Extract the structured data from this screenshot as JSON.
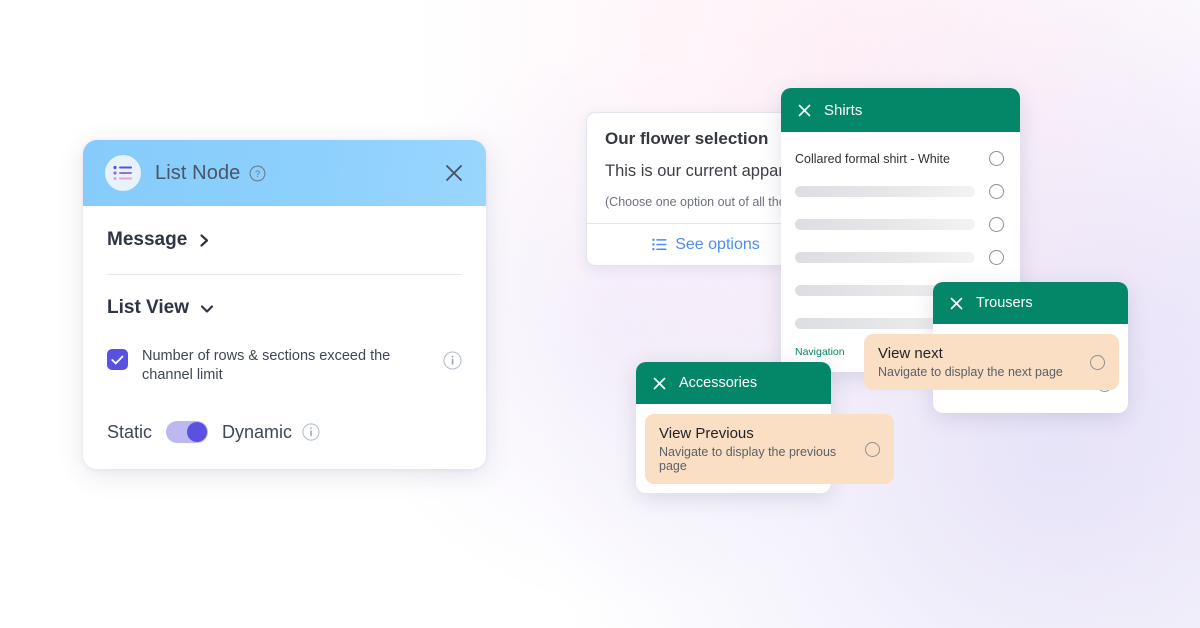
{
  "theme": {
    "header_blue": "#8acdfb",
    "green": "#048768",
    "peach": "#fbdfc5",
    "indigo": "#5a51e0",
    "link_blue": "#4a8bf4"
  },
  "list_node": {
    "icon": "list-icon",
    "title": "List Node",
    "help_icon": "question-circle-icon",
    "close_icon": "close-icon",
    "message": {
      "label": "Message",
      "chevron": "chevron-right-icon"
    },
    "list_view": {
      "label": "List View",
      "chevron": "chevron-down-icon"
    },
    "checkbox": {
      "checked": true,
      "label": "Number of rows & sections exceed the channel limit",
      "info_icon": "info-icon"
    },
    "toggle": {
      "left_label": "Static",
      "right_label": "Dynamic",
      "state": "Dynamic",
      "info_icon": "info-icon"
    }
  },
  "flower_card": {
    "title": "Our flower selection",
    "body": "This is our current apparel collection. Select the one your are interested on",
    "note": "(Choose one option out of all the options)",
    "action_label": "See options",
    "action_icon": "list-icon"
  },
  "panels": [
    {
      "id": "shirts",
      "close_icon": "close-icon",
      "title": "Shirts",
      "items": [
        {
          "type": "text",
          "label": "Collared formal shirt - White"
        },
        {
          "type": "placeholder"
        },
        {
          "type": "placeholder"
        },
        {
          "type": "placeholder"
        },
        {
          "type": "placeholder"
        },
        {
          "type": "placeholder"
        }
      ],
      "section_label": "Navigation"
    },
    {
      "id": "trousers",
      "close_icon": "close-icon",
      "title": "Trousers",
      "items": [
        {
          "type": "placeholder"
        },
        {
          "type": "placeholder"
        }
      ]
    },
    {
      "id": "accessories",
      "close_icon": "close-icon",
      "title": "Accessories",
      "items": [
        {
          "type": "placeholder"
        },
        {
          "type": "placeholder"
        }
      ]
    }
  ],
  "tooltips": {
    "view_next": {
      "title": "View next",
      "subtitle": "Navigate to display the next page"
    },
    "view_previous": {
      "title": "View Previous",
      "subtitle": "Navigate to display the previous page"
    }
  }
}
